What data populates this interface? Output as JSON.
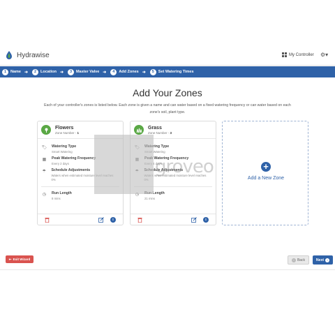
{
  "app": {
    "name": "Hydrawise"
  },
  "header": {
    "controller_label": "My Controller"
  },
  "steps": [
    {
      "num": "1",
      "label": "Name"
    },
    {
      "num": "2",
      "label": "Location"
    },
    {
      "num": "3",
      "label": "Master Valve"
    },
    {
      "num": "4",
      "label": "Add Zones"
    },
    {
      "num": "5",
      "label": "Set Watering Times"
    }
  ],
  "page": {
    "title": "Add Your Zones",
    "intro": "Each of your controller's zones is listed below. Each zone is given a name and can water based on a fixed watering frequency or can water based on each zone's soil, plant type."
  },
  "zones": [
    {
      "name": "Flowers",
      "number_label": "Zone Number - ",
      "number": "1",
      "watering_type_label": "Watering Type",
      "watering_type": "Smart Watering",
      "frequency_label": "Peak Watering Frequency",
      "frequency": "Every 2 days",
      "adjust_label": "Schedule Adjustments",
      "adjust": "Waters when estimated moisture level reaches 0%",
      "run_label": "Run Length",
      "run": "8 mins"
    },
    {
      "name": "Grass",
      "number_label": "Zone Number - ",
      "number": "3",
      "watering_type_label": "Watering Type",
      "watering_type": "Smart Watering",
      "frequency_label": "Peak Watering Frequency",
      "frequency": "Every 4 days",
      "adjust_label": "Schedule Adjustments",
      "adjust": "Waters when estimated moisture level reaches 0%",
      "run_label": "Run Length",
      "run": "21 mins"
    }
  ],
  "add_zone": {
    "label": "Add a New Zone"
  },
  "footer": {
    "exit_label": "Exit Wizard",
    "back_label": "Back",
    "next_label": "Next"
  },
  "watermark": {
    "text": "groveo"
  },
  "colors": {
    "primary": "#2f62a8",
    "danger": "#d9534f",
    "zone_icon": "#5aa845"
  }
}
